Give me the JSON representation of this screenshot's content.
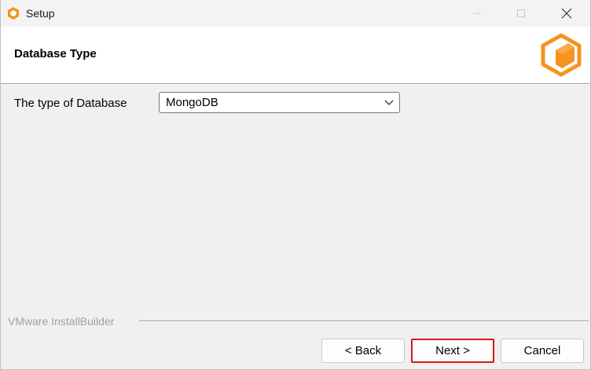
{
  "window": {
    "title": "Setup"
  },
  "header": {
    "title": "Database Type"
  },
  "form": {
    "db_type_label": "The type of Database",
    "db_type_value": "MongoDB"
  },
  "footer": {
    "brand": "VMware InstallBuilder",
    "back_label": "< Back",
    "next_label": "Next >",
    "cancel_label": "Cancel"
  },
  "colors": {
    "accent_orange": "#f7931e",
    "focus_red": "#d21a1a"
  },
  "icons": [
    "app-icon",
    "minimize-icon",
    "maximize-icon",
    "close-icon",
    "installbuilder-logo-icon",
    "chevron-down-icon"
  ]
}
